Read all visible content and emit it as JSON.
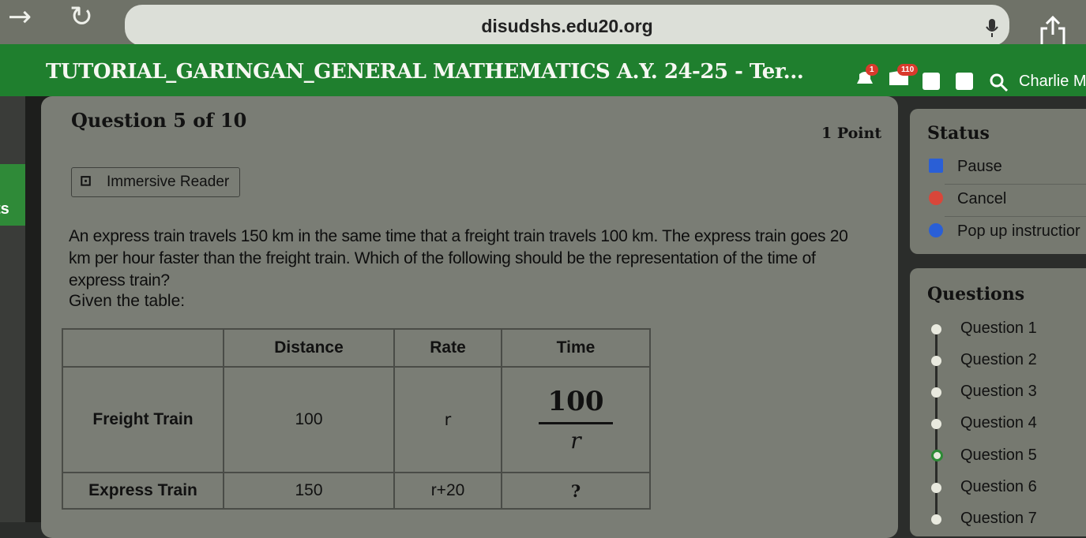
{
  "browser": {
    "url": "disudshs.edu20.org"
  },
  "header": {
    "course_title": "TUTORIAL_GARINGAN_GENERAL MATHEMATICS A.Y. 24-25 - Ter...",
    "notification_count": "1",
    "message_count": "110",
    "user_name": "Charlie M"
  },
  "left_tab_label": "ts",
  "question": {
    "number_label": "Question 5 of 10",
    "points_label": "1 Point",
    "immersive_reader_label": "Immersive Reader",
    "text": "An express train travels 150 km in the same time that a freight train travels 100 km. The express train goes 20 km per hour faster than the freight train. Which of the following should be the representation of the time of express train?",
    "given_label": "Given the table:",
    "table": {
      "headers": [
        "",
        "Distance",
        "Rate",
        "Time"
      ],
      "rows": [
        {
          "label": "Freight Train",
          "distance": "100",
          "rate": "r",
          "time_num": "100",
          "time_den": "r"
        },
        {
          "label": "Express Train",
          "distance": "150",
          "rate": "r+20",
          "time": "?"
        }
      ]
    }
  },
  "status": {
    "title": "Status",
    "items": [
      {
        "label": "Pause",
        "color": "#2a5fd6"
      },
      {
        "label": "Cancel",
        "color": "#d9463a"
      },
      {
        "label": "Pop up instructior",
        "color": "#2a5fd6"
      }
    ]
  },
  "questions_panel": {
    "title": "Questions",
    "items": [
      "Question 1",
      "Question 2",
      "Question 3",
      "Question 4",
      "Question 5",
      "Question 6",
      "Question 7"
    ],
    "current": "Question 5"
  }
}
